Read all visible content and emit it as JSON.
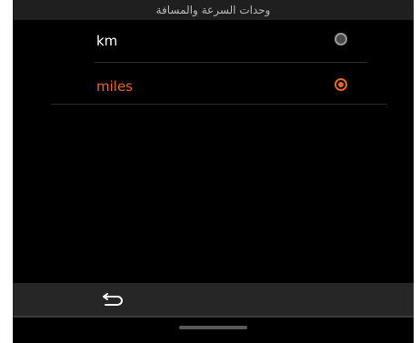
{
  "title": "وحدات السرعة والمسافة",
  "options": [
    {
      "label": "km",
      "selected": false
    },
    {
      "label": "miles",
      "selected": true
    }
  ],
  "colors": {
    "accent": "#e8652a",
    "background": "#000000",
    "title_bar": "#1f1f1f",
    "bottom_bar": "#262626"
  },
  "icons": {
    "back": "back-arrow-icon"
  }
}
